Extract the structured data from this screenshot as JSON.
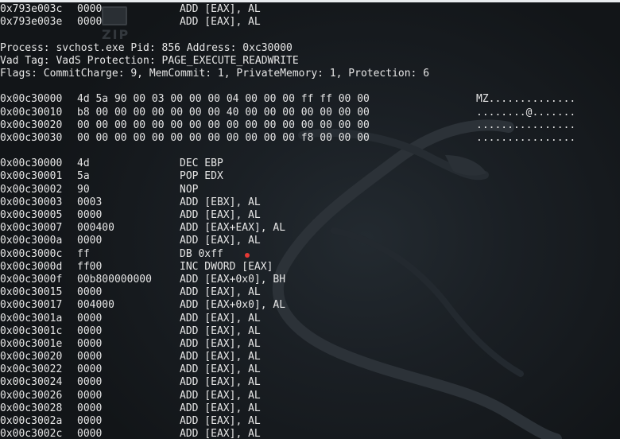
{
  "watermark": {
    "label": "ZIP"
  },
  "top_disasm": [
    {
      "addr": "0x793e003c",
      "bytes": "0000",
      "instr": "ADD [EAX], AL"
    },
    {
      "addr": "0x793e003e",
      "bytes": "0000",
      "instr": "ADD [EAX], AL"
    }
  ],
  "process_info": {
    "line1": "Process: svchost.exe Pid: 856 Address: 0xc30000",
    "line2": "Vad Tag: VadS Protection: PAGE_EXECUTE_READWRITE",
    "line3": "Flags: CommitCharge: 9, MemCommit: 1, PrivateMemory: 1, Protection: 6"
  },
  "hexdump": [
    {
      "addr": "0x00c30000",
      "hex": "4d 5a 90 00 03 00 00 00 04 00 00 00 ff ff 00 00",
      "ascii": "MZ.............."
    },
    {
      "addr": "0x00c30010",
      "hex": "b8 00 00 00 00 00 00 00 40 00 00 00 00 00 00 00",
      "ascii": "........@......."
    },
    {
      "addr": "0x00c30020",
      "hex": "00 00 00 00 00 00 00 00 00 00 00 00 00 00 00 00",
      "ascii": "................"
    },
    {
      "addr": "0x00c30030",
      "hex": "00 00 00 00 00 00 00 00 00 00 00 00 f8 00 00 00",
      "ascii": "................"
    }
  ],
  "disasm": [
    {
      "addr": "0x00c30000",
      "bytes": "4d",
      "instr": "DEC EBP"
    },
    {
      "addr": "0x00c30001",
      "bytes": "5a",
      "instr": "POP EDX"
    },
    {
      "addr": "0x00c30002",
      "bytes": "90",
      "instr": "NOP"
    },
    {
      "addr": "0x00c30003",
      "bytes": "0003",
      "instr": "ADD [EBX], AL"
    },
    {
      "addr": "0x00c30005",
      "bytes": "0000",
      "instr": "ADD [EAX], AL"
    },
    {
      "addr": "0x00c30007",
      "bytes": "000400",
      "instr": "ADD [EAX+EAX], AL"
    },
    {
      "addr": "0x00c3000a",
      "bytes": "0000",
      "instr": "ADD [EAX], AL"
    },
    {
      "addr": "0x00c3000c",
      "bytes": "ff",
      "instr": "DB 0xff"
    },
    {
      "addr": "0x00c3000d",
      "bytes": "ff00",
      "instr": "INC DWORD [EAX]"
    },
    {
      "addr": "0x00c3000f",
      "bytes": "00b800000000",
      "instr": "ADD [EAX+0x0], BH"
    },
    {
      "addr": "0x00c30015",
      "bytes": "0000",
      "instr": "ADD [EAX], AL"
    },
    {
      "addr": "0x00c30017",
      "bytes": "004000",
      "instr": "ADD [EAX+0x0], AL"
    },
    {
      "addr": "0x00c3001a",
      "bytes": "0000",
      "instr": "ADD [EAX], AL"
    },
    {
      "addr": "0x00c3001c",
      "bytes": "0000",
      "instr": "ADD [EAX], AL"
    },
    {
      "addr": "0x00c3001e",
      "bytes": "0000",
      "instr": "ADD [EAX], AL"
    },
    {
      "addr": "0x00c30020",
      "bytes": "0000",
      "instr": "ADD [EAX], AL"
    },
    {
      "addr": "0x00c30022",
      "bytes": "0000",
      "instr": "ADD [EAX], AL"
    },
    {
      "addr": "0x00c30024",
      "bytes": "0000",
      "instr": "ADD [EAX], AL"
    },
    {
      "addr": "0x00c30026",
      "bytes": "0000",
      "instr": "ADD [EAX], AL"
    },
    {
      "addr": "0x00c30028",
      "bytes": "0000",
      "instr": "ADD [EAX], AL"
    },
    {
      "addr": "0x00c3002a",
      "bytes": "0000",
      "instr": "ADD [EAX], AL"
    },
    {
      "addr": "0x00c3002c",
      "bytes": "0000",
      "instr": "ADD [EAX], AL"
    }
  ],
  "colors": {
    "background": "#1a1f24",
    "text": "#e6e6e6",
    "cursor_dot": "#e53935"
  }
}
